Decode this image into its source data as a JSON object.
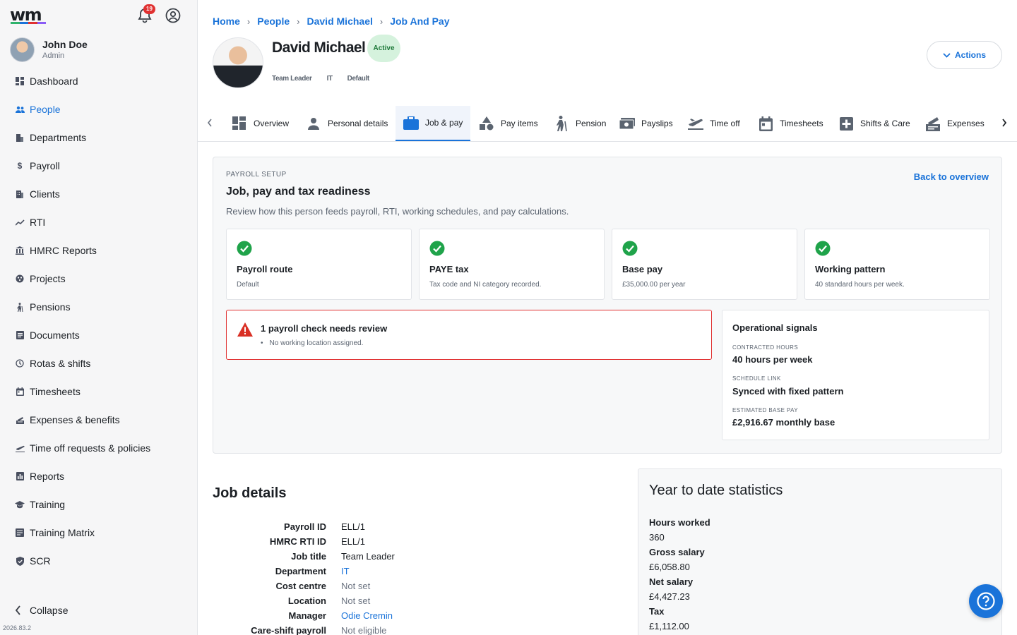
{
  "app": {
    "logo_text": "wm",
    "logo_colors": [
      "#2fb36b",
      "#1a73d9",
      "#e03131",
      "#8b5cf6"
    ],
    "notification_count": "19",
    "version": "2026.83.2"
  },
  "user": {
    "name": "John Doe",
    "role": "Admin"
  },
  "sidebar": {
    "items": [
      {
        "label": "Dashboard",
        "icon": "dashboard-icon"
      },
      {
        "label": "People",
        "icon": "people-icon"
      },
      {
        "label": "Departments",
        "icon": "departments-icon"
      },
      {
        "label": "Payroll",
        "icon": "dollar-icon"
      },
      {
        "label": "Clients",
        "icon": "clients-icon"
      },
      {
        "label": "RTI",
        "icon": "trend-icon"
      },
      {
        "label": "HMRC Reports",
        "icon": "bank-icon"
      },
      {
        "label": "Projects",
        "icon": "projects-icon"
      },
      {
        "label": "Pensions",
        "icon": "pensions-icon"
      },
      {
        "label": "Documents",
        "icon": "documents-icon"
      },
      {
        "label": "Rotas & shifts",
        "icon": "clock-icon"
      },
      {
        "label": "Timesheets",
        "icon": "calendar-icon"
      },
      {
        "label": "Expenses & benefits",
        "icon": "expenses-icon"
      },
      {
        "label": "Time off requests & policies",
        "icon": "plane-icon"
      },
      {
        "label": "Reports",
        "icon": "reports-icon"
      },
      {
        "label": "Training",
        "icon": "graduation-icon"
      },
      {
        "label": "Training Matrix",
        "icon": "matrix-icon"
      },
      {
        "label": "SCR",
        "icon": "shield-icon"
      }
    ],
    "active_index": 1,
    "collapse_label": "Collapse"
  },
  "breadcrumb": [
    "Home",
    "People",
    "David Michael",
    "Job And Pay"
  ],
  "person": {
    "name": "David Michael",
    "status": "Active",
    "chips": [
      "Team Leader",
      "IT",
      "Default"
    ]
  },
  "actions_label": "Actions",
  "tabs": [
    {
      "label": "Overview",
      "icon": "overview-icon"
    },
    {
      "label": "Personal details",
      "icon": "person-icon"
    },
    {
      "label": "Job & pay",
      "icon": "briefcase-icon"
    },
    {
      "label": "Pay items",
      "icon": "shapes-icon"
    },
    {
      "label": "Pension",
      "icon": "walking-icon"
    },
    {
      "label": "Payslips",
      "icon": "money-icon"
    },
    {
      "label": "Time off",
      "icon": "plane-icon"
    },
    {
      "label": "Timesheets",
      "icon": "calendar-icon"
    },
    {
      "label": "Shifts & Care",
      "icon": "plus-box-icon"
    },
    {
      "label": "Expenses",
      "icon": "expenses-icon"
    }
  ],
  "active_tab": 2,
  "setup": {
    "kicker": "PAYROLL SETUP",
    "title": "Job, pay and tax readiness",
    "description": "Review how this person feeds payroll, RTI, working schedules, and pay calculations.",
    "back_label": "Back to overview",
    "checks": [
      {
        "title": "Payroll route",
        "sub": "Default"
      },
      {
        "title": "PAYE tax",
        "sub": "Tax code and NI category recorded."
      },
      {
        "title": "Base pay",
        "sub": "£35,000.00 per year"
      },
      {
        "title": "Working pattern",
        "sub": "40 standard hours per week."
      }
    ],
    "alert": {
      "title": "1 payroll check needs review",
      "items": [
        "No working location assigned."
      ]
    },
    "signals": {
      "title": "Operational signals",
      "rows": [
        {
          "label": "CONTRACTED HOURS",
          "value": "40 hours per week"
        },
        {
          "label": "SCHEDULE LINK",
          "value": "Synced with fixed pattern"
        },
        {
          "label": "ESTIMATED BASE PAY",
          "value": "£2,916.67 monthly base"
        }
      ]
    }
  },
  "job_details": {
    "title": "Job details",
    "rows": [
      {
        "key": "Payroll ID",
        "value": "ELL/1",
        "style": "plain"
      },
      {
        "key": "HMRC RTI ID",
        "value": "ELL/1",
        "style": "plain"
      },
      {
        "key": "Job title",
        "value": "Team Leader",
        "style": "plain"
      },
      {
        "key": "Department",
        "value": "IT",
        "style": "link"
      },
      {
        "key": "Cost centre",
        "value": "Not set",
        "style": "muted"
      },
      {
        "key": "Location",
        "value": "Not set",
        "style": "muted"
      },
      {
        "key": "Manager",
        "value": "Odie Cremin",
        "style": "link"
      },
      {
        "key": "Care-shift payroll",
        "value": "Not eligible",
        "style": "muted"
      }
    ]
  },
  "ytd": {
    "title": "Year to date statistics",
    "rows": [
      {
        "key": "Hours worked",
        "value": "360"
      },
      {
        "key": "Gross salary",
        "value": "£6,058.80"
      },
      {
        "key": "Net salary",
        "value": "£4,427.23"
      },
      {
        "key": "Tax",
        "value": "£1,112.00"
      }
    ]
  },
  "colors": {
    "accent": "#1a73d9",
    "success": "#1fa34a",
    "danger": "#e03131",
    "active_pill": "#d5f2dd"
  }
}
